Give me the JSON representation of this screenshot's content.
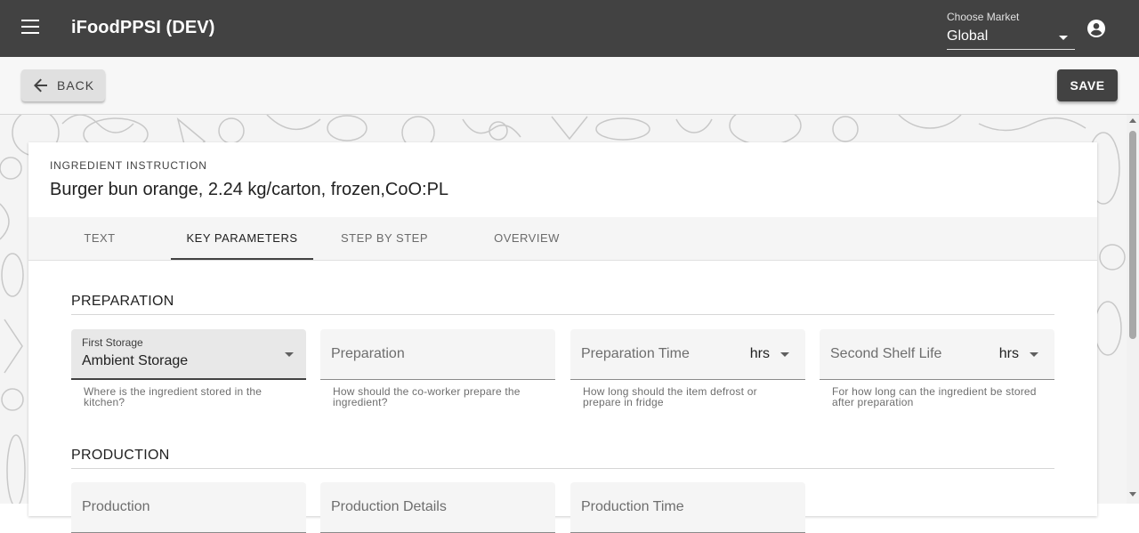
{
  "header": {
    "title": "iFoodPPSI (DEV)",
    "market_label": "Choose Market",
    "market_value": "Global"
  },
  "toolbar": {
    "back_label": "BACK",
    "save_label": "SAVE"
  },
  "card": {
    "overline": "INGREDIENT INSTRUCTION",
    "title": "Burger bun orange, 2.24 kg/carton, frozen,CoO:PL"
  },
  "tabs": [
    {
      "label": "TEXT",
      "active": false
    },
    {
      "label": "KEY PARAMETERS",
      "active": true
    },
    {
      "label": "STEP BY STEP",
      "active": false
    },
    {
      "label": "OVERVIEW",
      "active": false
    }
  ],
  "preparation": {
    "title": "PREPARATION",
    "fields": [
      {
        "label": "First Storage",
        "value": "Ambient Storage",
        "helper": "Where is the ingredient stored in the kitchen?"
      },
      {
        "placeholder": "Preparation",
        "helper": "How should the co-worker prepare the ingredient?"
      },
      {
        "placeholder": "Preparation Time",
        "unit": "hrs",
        "helper": "How long should the item defrost or prepare in fridge"
      },
      {
        "placeholder": "Second Shelf Life",
        "unit": "hrs",
        "helper": "For how long can the ingredient be stored after preparation"
      }
    ]
  },
  "production": {
    "title": "PRODUCTION",
    "fields": [
      {
        "placeholder": "Production"
      },
      {
        "placeholder": "Production Details"
      },
      {
        "placeholder": "Production Time"
      }
    ]
  },
  "colors": {
    "appbar": "#424242",
    "accent": "#424242",
    "background": "#f4f4f4"
  }
}
